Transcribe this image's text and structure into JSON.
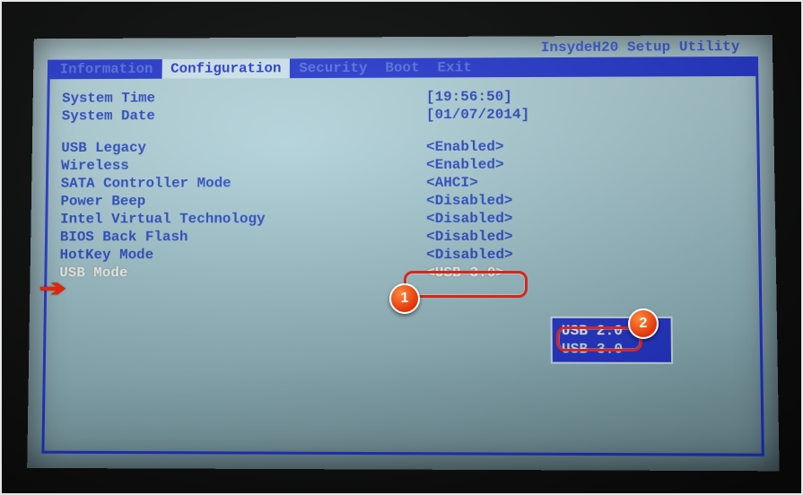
{
  "brand": "InsydeH20 Setup Utility",
  "tabs": {
    "information": "Information",
    "configuration": "Configuration",
    "security": "Security",
    "boot": "Boot",
    "exit": "Exit"
  },
  "active_tab": "configuration",
  "settings": {
    "system_time": {
      "label": "System Time",
      "value": "[19:56:50]"
    },
    "system_date": {
      "label": "System Date",
      "value": "[01/07/2014]"
    },
    "usb_legacy": {
      "label": "USB Legacy",
      "value": "<Enabled>"
    },
    "wireless": {
      "label": "Wireless",
      "value": "<Enabled>"
    },
    "sata_mode": {
      "label": "SATA Controller Mode",
      "value": "<AHCI>"
    },
    "power_beep": {
      "label": "Power Beep",
      "value": "<Disabled>"
    },
    "intel_vt": {
      "label": "Intel Virtual Technology",
      "value": "<Disabled>"
    },
    "bios_backflash": {
      "label": "BIOS Back Flash",
      "value": "<Disabled>"
    },
    "hotkey_mode": {
      "label": "HotKey Mode",
      "value": "<Disabled>"
    },
    "usb_mode": {
      "label": "USB Mode",
      "value": "<USB 3.0>"
    }
  },
  "popup": {
    "options": [
      "USB 2.0",
      "USB 3.0"
    ],
    "selected": "USB 2.0"
  },
  "annotations": {
    "arrow_target": "usb_mode_label",
    "callout1_number": "1",
    "callout2_number": "2"
  }
}
